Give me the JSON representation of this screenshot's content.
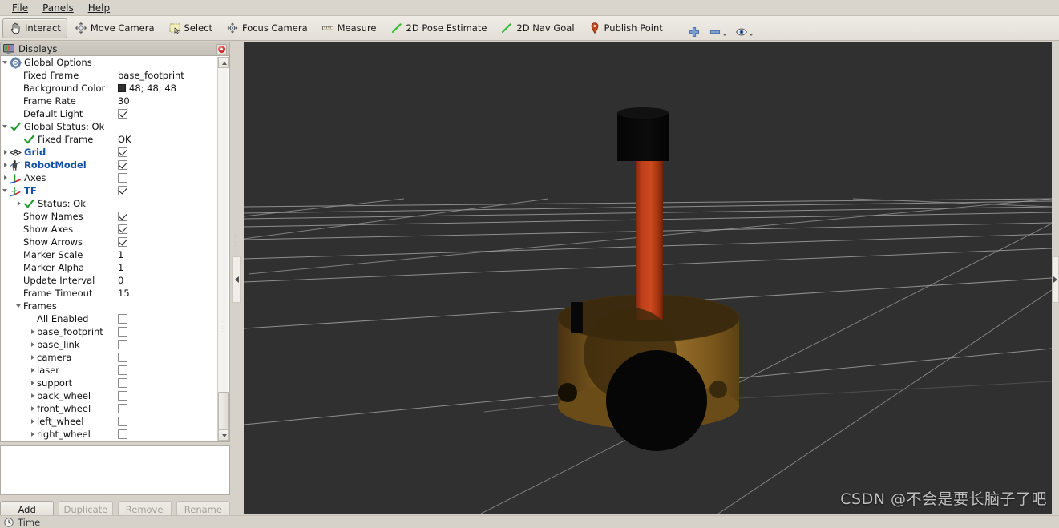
{
  "menubar": {
    "items": [
      {
        "label": "File",
        "mnemonic": "F"
      },
      {
        "label": "Panels",
        "mnemonic": "P"
      },
      {
        "label": "Help",
        "mnemonic": "H"
      }
    ]
  },
  "toolbar": {
    "tools": [
      {
        "label": "Interact",
        "icon": "hand-cursor-icon",
        "active": true
      },
      {
        "label": "Move Camera",
        "icon": "move-camera-icon",
        "active": false
      },
      {
        "label": "Select",
        "icon": "select-rectangle-icon",
        "active": false
      },
      {
        "label": "Focus Camera",
        "icon": "focus-camera-icon",
        "active": false
      },
      {
        "label": "Measure",
        "icon": "ruler-icon",
        "active": false
      },
      {
        "label": "2D Pose Estimate",
        "icon": "pose-arrow-icon",
        "active": false
      },
      {
        "label": "2D Nav Goal",
        "icon": "nav-goal-arrow-icon",
        "active": false
      },
      {
        "label": "Publish Point",
        "icon": "map-pin-icon",
        "active": false
      }
    ],
    "extras": [
      {
        "name": "add-tool-button",
        "icon": "plus-icon",
        "caret": false
      },
      {
        "name": "remove-tool-button",
        "icon": "minus-icon",
        "caret": true
      },
      {
        "name": "view-tool-button",
        "icon": "eye-icon",
        "caret": true
      }
    ]
  },
  "displays_panel": {
    "title": "Displays",
    "close_button": "close-icon",
    "tree": [
      {
        "indent": 0,
        "twisty": "open",
        "icon": "gear-icon",
        "label": "Global Options",
        "style": "plain",
        "value_type": "none"
      },
      {
        "indent": 1,
        "twisty": "none",
        "icon": "none",
        "label": "Fixed Frame",
        "style": "plain",
        "value_type": "text",
        "value": "base_footprint"
      },
      {
        "indent": 1,
        "twisty": "none",
        "icon": "none",
        "label": "Background Color",
        "style": "plain",
        "value_type": "color",
        "value": "48; 48; 48",
        "swatch": "#303030"
      },
      {
        "indent": 1,
        "twisty": "none",
        "icon": "none",
        "label": "Frame Rate",
        "style": "plain",
        "value_type": "text",
        "value": "30"
      },
      {
        "indent": 1,
        "twisty": "none",
        "icon": "none",
        "label": "Default Light",
        "style": "plain",
        "value_type": "checkbox",
        "checked": true
      },
      {
        "indent": 0,
        "twisty": "open",
        "icon": "check-icon",
        "label": "Global Status: Ok",
        "style": "plain",
        "value_type": "none"
      },
      {
        "indent": 1,
        "twisty": "none",
        "icon": "check-icon",
        "label": "Fixed Frame",
        "style": "plain",
        "value_type": "text",
        "value": "OK"
      },
      {
        "indent": 0,
        "twisty": "closed",
        "icon": "grid-icon",
        "label": "Grid",
        "style": "blue",
        "value_type": "checkbox",
        "checked": true
      },
      {
        "indent": 0,
        "twisty": "closed",
        "icon": "robot-icon",
        "label": "RobotModel",
        "style": "blue",
        "value_type": "checkbox",
        "checked": true
      },
      {
        "indent": 0,
        "twisty": "closed",
        "icon": "axes-icon",
        "label": "Axes",
        "style": "plain",
        "value_type": "checkbox",
        "checked": false
      },
      {
        "indent": 0,
        "twisty": "open",
        "icon": "tf-icon",
        "label": "TF",
        "style": "blue",
        "value_type": "checkbox",
        "checked": true
      },
      {
        "indent": 1,
        "twisty": "closed",
        "icon": "check-icon",
        "label": "Status: Ok",
        "style": "plain",
        "value_type": "none"
      },
      {
        "indent": 1,
        "twisty": "none",
        "icon": "none",
        "label": "Show Names",
        "style": "plain",
        "value_type": "checkbox",
        "checked": true
      },
      {
        "indent": 1,
        "twisty": "none",
        "icon": "none",
        "label": "Show Axes",
        "style": "plain",
        "value_type": "checkbox",
        "checked": true
      },
      {
        "indent": 1,
        "twisty": "none",
        "icon": "none",
        "label": "Show Arrows",
        "style": "plain",
        "value_type": "checkbox",
        "checked": true
      },
      {
        "indent": 1,
        "twisty": "none",
        "icon": "none",
        "label": "Marker Scale",
        "style": "plain",
        "value_type": "text",
        "value": "1"
      },
      {
        "indent": 1,
        "twisty": "none",
        "icon": "none",
        "label": "Marker Alpha",
        "style": "plain",
        "value_type": "text",
        "value": "1"
      },
      {
        "indent": 1,
        "twisty": "none",
        "icon": "none",
        "label": "Update Interval",
        "style": "plain",
        "value_type": "text",
        "value": "0"
      },
      {
        "indent": 1,
        "twisty": "none",
        "icon": "none",
        "label": "Frame Timeout",
        "style": "plain",
        "value_type": "text",
        "value": "15"
      },
      {
        "indent": 1,
        "twisty": "open",
        "icon": "none",
        "label": "Frames",
        "style": "plain",
        "value_type": "none"
      },
      {
        "indent": 2,
        "twisty": "none",
        "icon": "none",
        "label": "All Enabled",
        "style": "plain",
        "value_type": "checkbox",
        "checked": false
      },
      {
        "indent": 2,
        "twisty": "closed",
        "icon": "none",
        "label": "base_footprint",
        "style": "plain",
        "value_type": "checkbox",
        "checked": false
      },
      {
        "indent": 2,
        "twisty": "closed",
        "icon": "none",
        "label": "base_link",
        "style": "plain",
        "value_type": "checkbox",
        "checked": false
      },
      {
        "indent": 2,
        "twisty": "closed",
        "icon": "none",
        "label": "camera",
        "style": "plain",
        "value_type": "checkbox",
        "checked": false
      },
      {
        "indent": 2,
        "twisty": "closed",
        "icon": "none",
        "label": "laser",
        "style": "plain",
        "value_type": "checkbox",
        "checked": false
      },
      {
        "indent": 2,
        "twisty": "closed",
        "icon": "none",
        "label": "support",
        "style": "plain",
        "value_type": "checkbox",
        "checked": false
      },
      {
        "indent": 2,
        "twisty": "closed",
        "icon": "none",
        "label": "back_wheel",
        "style": "plain",
        "value_type": "checkbox",
        "checked": false
      },
      {
        "indent": 2,
        "twisty": "closed",
        "icon": "none",
        "label": "front_wheel",
        "style": "plain",
        "value_type": "checkbox",
        "checked": false
      },
      {
        "indent": 2,
        "twisty": "closed",
        "icon": "none",
        "label": "left_wheel",
        "style": "plain",
        "value_type": "checkbox",
        "checked": false
      },
      {
        "indent": 2,
        "twisty": "closed",
        "icon": "none",
        "label": "right_wheel",
        "style": "plain",
        "value_type": "checkbox",
        "checked": false
      }
    ],
    "buttons": [
      {
        "label": "Add",
        "enabled": true
      },
      {
        "label": "Duplicate",
        "enabled": false
      },
      {
        "label": "Remove",
        "enabled": false
      },
      {
        "label": "Rename",
        "enabled": false
      }
    ]
  },
  "view3d": {
    "background_color": "#303030",
    "grid_line_color": "#a8a8a8",
    "watermark": "CSDN @不会是要长脑子了吧",
    "robot": {
      "body_color": "#8a6320",
      "body_color_dark": "#5a4015",
      "pole_color": "#bf3d1a",
      "top_box_color": "#050505",
      "wheel_color": "#060606"
    }
  },
  "time_panel": {
    "label": "Time",
    "icon": "clock-icon"
  }
}
